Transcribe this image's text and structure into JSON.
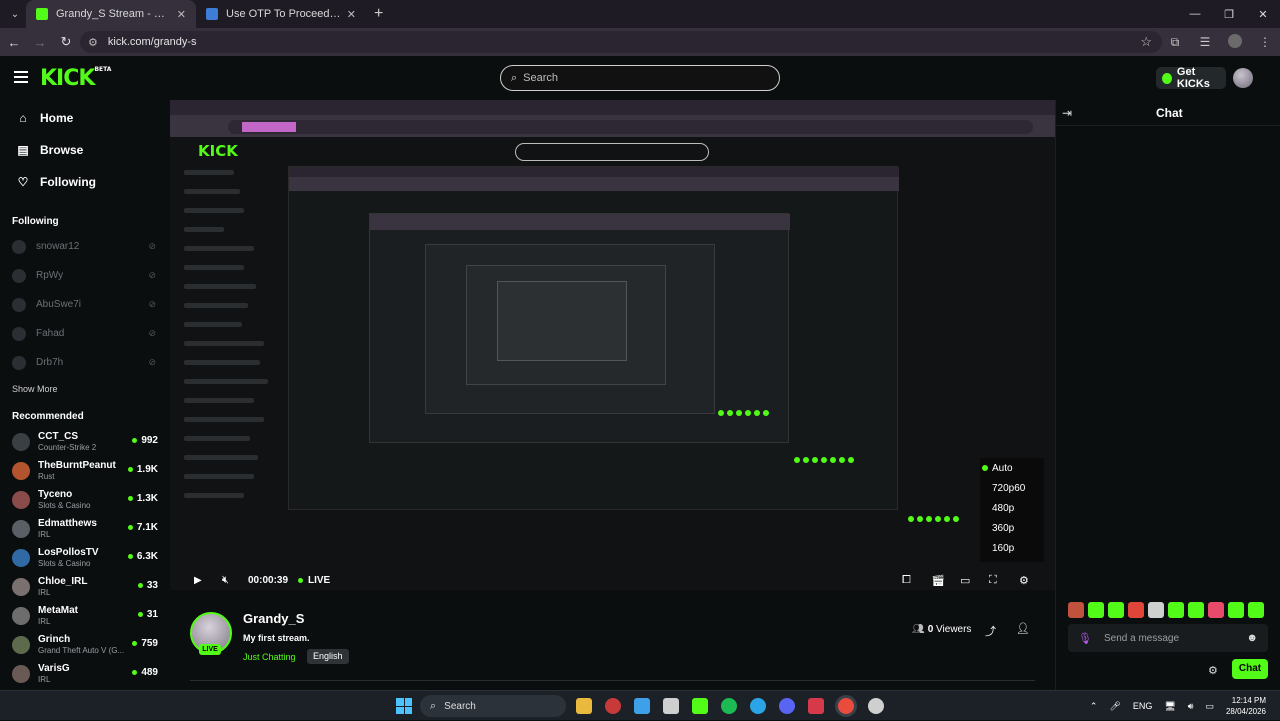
{
  "browser": {
    "tabs": [
      {
        "title": "Grandy_S Stream - Watch Live o",
        "active": true,
        "favicon_color": "#53fc18"
      },
      {
        "title": "Use OTP To Proceed - osamabi",
        "active": false,
        "favicon_color": "#3d7dd8"
      }
    ],
    "url": "kick.com/grandy-s"
  },
  "header": {
    "logo": "KICK",
    "logo_badge": "BETA",
    "search_placeholder": "Search",
    "get_kicks": "Get KICKs"
  },
  "sidebar": {
    "nav": [
      {
        "label": "Home",
        "icon": "home-icon"
      },
      {
        "label": "Browse",
        "icon": "browse-icon"
      },
      {
        "label": "Following",
        "icon": "heart-icon"
      }
    ],
    "following_title": "Following",
    "following": [
      "snowar12",
      "RpWy",
      "AbuSwe7i",
      "Fahad",
      "Drb7h"
    ],
    "show_more": "Show More",
    "recommended_title": "Recommended",
    "recommended": [
      {
        "name": "CCT_CS",
        "category": "Counter-Strike 2",
        "viewers": "992",
        "color": "#3a3f44"
      },
      {
        "name": "TheBurntPeanut",
        "category": "Rust",
        "viewers": "1.9K",
        "color": "#b2552e"
      },
      {
        "name": "Tyceno",
        "category": "Slots & Casino",
        "viewers": "1.3K",
        "color": "#8a4b4b"
      },
      {
        "name": "Edmatthews",
        "category": "IRL",
        "viewers": "7.1K",
        "color": "#5a5f66"
      },
      {
        "name": "LosPollosTV",
        "category": "Slots & Casino",
        "viewers": "6.3K",
        "color": "#2f6aa5"
      },
      {
        "name": "Chloe_IRL",
        "category": "IRL",
        "viewers": "33",
        "color": "#7b7070"
      },
      {
        "name": "MetaMat",
        "category": "IRL",
        "viewers": "31",
        "color": "#6d6d6d"
      },
      {
        "name": "Grinch",
        "category": "Grand Theft Auto V (G...",
        "viewers": "759",
        "color": "#5d6a4b"
      },
      {
        "name": "VarisG",
        "category": "IRL",
        "viewers": "489",
        "color": "#6a5a55"
      }
    ]
  },
  "player": {
    "time": "00:00:39",
    "live_label": "LIVE",
    "quality_options": [
      "Auto",
      "720p60",
      "480p",
      "360p",
      "160p"
    ],
    "quality_selected": "Auto"
  },
  "stream": {
    "streamer": "Grandy_S",
    "title": "My first stream.",
    "category": "Just Chatting",
    "language": "English",
    "live_badge": "LIVE",
    "viewers_count": "0",
    "viewers_label": "Viewers"
  },
  "chat": {
    "title": "Chat",
    "input_placeholder": "Send a message",
    "send_label": "Chat",
    "emote_colors": [
      "#c0523e",
      "#53fc18",
      "#53fc18",
      "#e0453a",
      "#cfcfcf",
      "#53fc18",
      "#53fc18",
      "#e84a6a",
      "#53fc18",
      "#53fc18"
    ]
  },
  "taskbar": {
    "search_placeholder": "Search",
    "language": "ENG",
    "time": "12:14 PM",
    "date": "28/04/2026",
    "app_colors": [
      "#e8b93c",
      "#c83a3a",
      "#3ea0e8",
      "#cfcfcf",
      "#53fc18",
      "#1db954",
      "#2aa4e6",
      "#5865f2",
      "#d63a4a",
      "#e94b3c",
      "#cfcfcf"
    ]
  },
  "nested_screen": {
    "urlbar_selected": "kick.com/grandy-s"
  }
}
